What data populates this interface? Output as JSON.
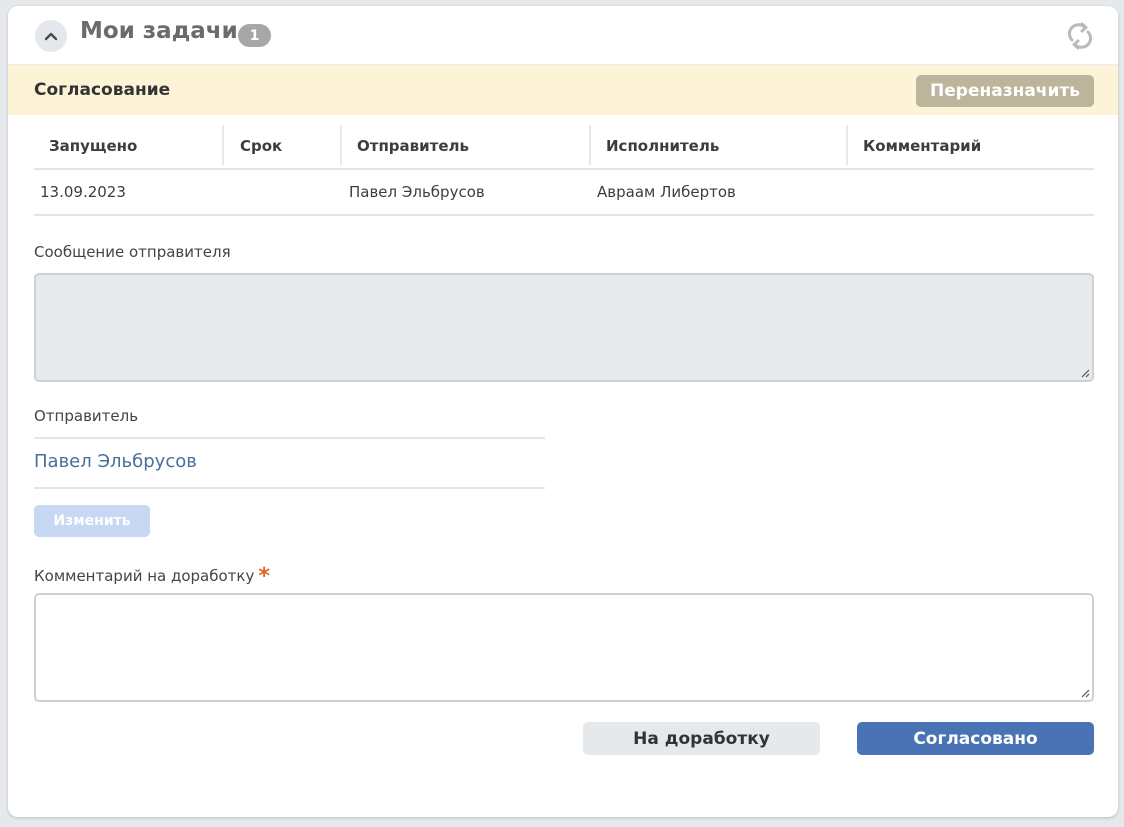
{
  "header": {
    "title": "Мои задачи",
    "count": "1",
    "collapse_icon": "chevron-up-icon",
    "refresh_icon": "refresh-icon"
  },
  "section": {
    "title": "Согласование",
    "reassign_label": "Переназначить"
  },
  "table": {
    "columns": [
      "Запущено",
      "Срок",
      "Отправитель",
      "Исполнитель",
      "Комментарий"
    ],
    "rows": [
      [
        "13.09.2023",
        "",
        "Павел Эльбрусов",
        "Авраам Либертов",
        ""
      ]
    ]
  },
  "sender_message": {
    "label": "Сообщение отправителя",
    "value": ""
  },
  "sender": {
    "label": "Отправитель",
    "name": "Павел Эльбрусов",
    "change_label": "Изменить"
  },
  "rework_comment": {
    "label": "Комментарий на доработку",
    "required_mark": "*",
    "value": ""
  },
  "actions": {
    "rework_label": "На доработку",
    "approve_label": "Согласовано"
  },
  "colors": {
    "section_bg": "#fdf3d6",
    "reassign_bg": "#bcb59b",
    "approve_bg": "#4a73b5",
    "link": "#4a6f9c",
    "required": "#e0632a"
  }
}
